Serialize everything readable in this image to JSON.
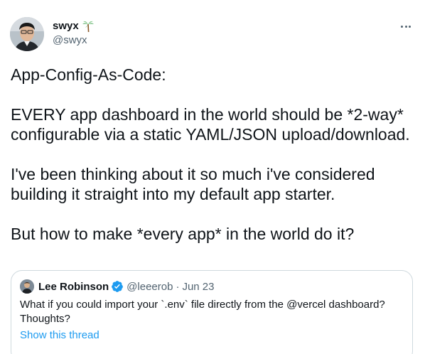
{
  "author": {
    "display_name": "swyx",
    "handle": "@swyx"
  },
  "tweet": {
    "paragraphs": [
      "App-Config-As-Code:",
      "EVERY app dashboard in the world should be *2-way* configurable via a static YAML/JSON upload/download.",
      "I've been thinking about it so much i've considered building it straight into my default app starter.",
      "But how to make *every app* in the world do it?"
    ]
  },
  "quoted_tweet": {
    "display_name": "Lee Robinson",
    "handle": "@leeerob",
    "separator": "·",
    "date": "Jun 23",
    "text_line1": "What if you could import your `.env` file directly from the @vercel dashboard?",
    "text_line2": "Thoughts?",
    "show_thread": "Show this thread"
  },
  "colors": {
    "text_primary": "#0f1419",
    "text_secondary": "#536471",
    "link": "#1d9bf0",
    "border": "#cfd9de"
  },
  "icons": {
    "more": "more-horizontal-icon",
    "emoji": "palm-tree-emoji",
    "verified": "verified-badge-icon"
  }
}
